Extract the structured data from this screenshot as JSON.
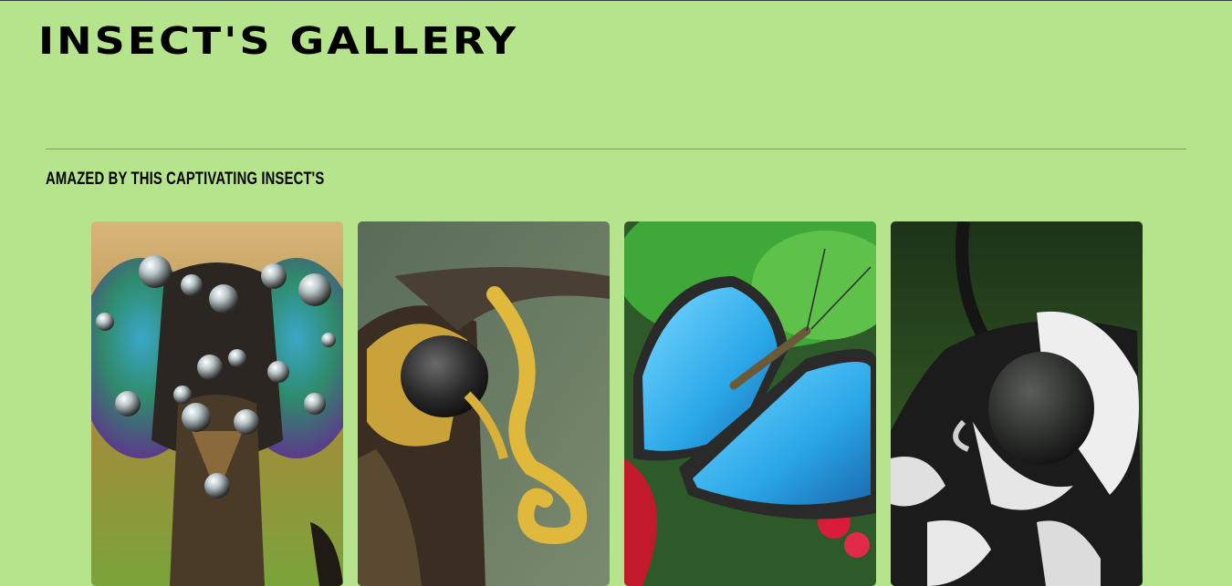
{
  "header": {
    "title": "INSECT'S GALLERY"
  },
  "main": {
    "subtitle": "AMAZED BY THIS CAPTIVATING INSECT'S"
  },
  "gallery": {
    "images": [
      {
        "subject": "robber fly head with dew drops"
      },
      {
        "subject": "moth with yellow curled proboscis"
      },
      {
        "subject": "blue morpho butterfly"
      },
      {
        "subject": "black and white moth close-up"
      }
    ]
  }
}
